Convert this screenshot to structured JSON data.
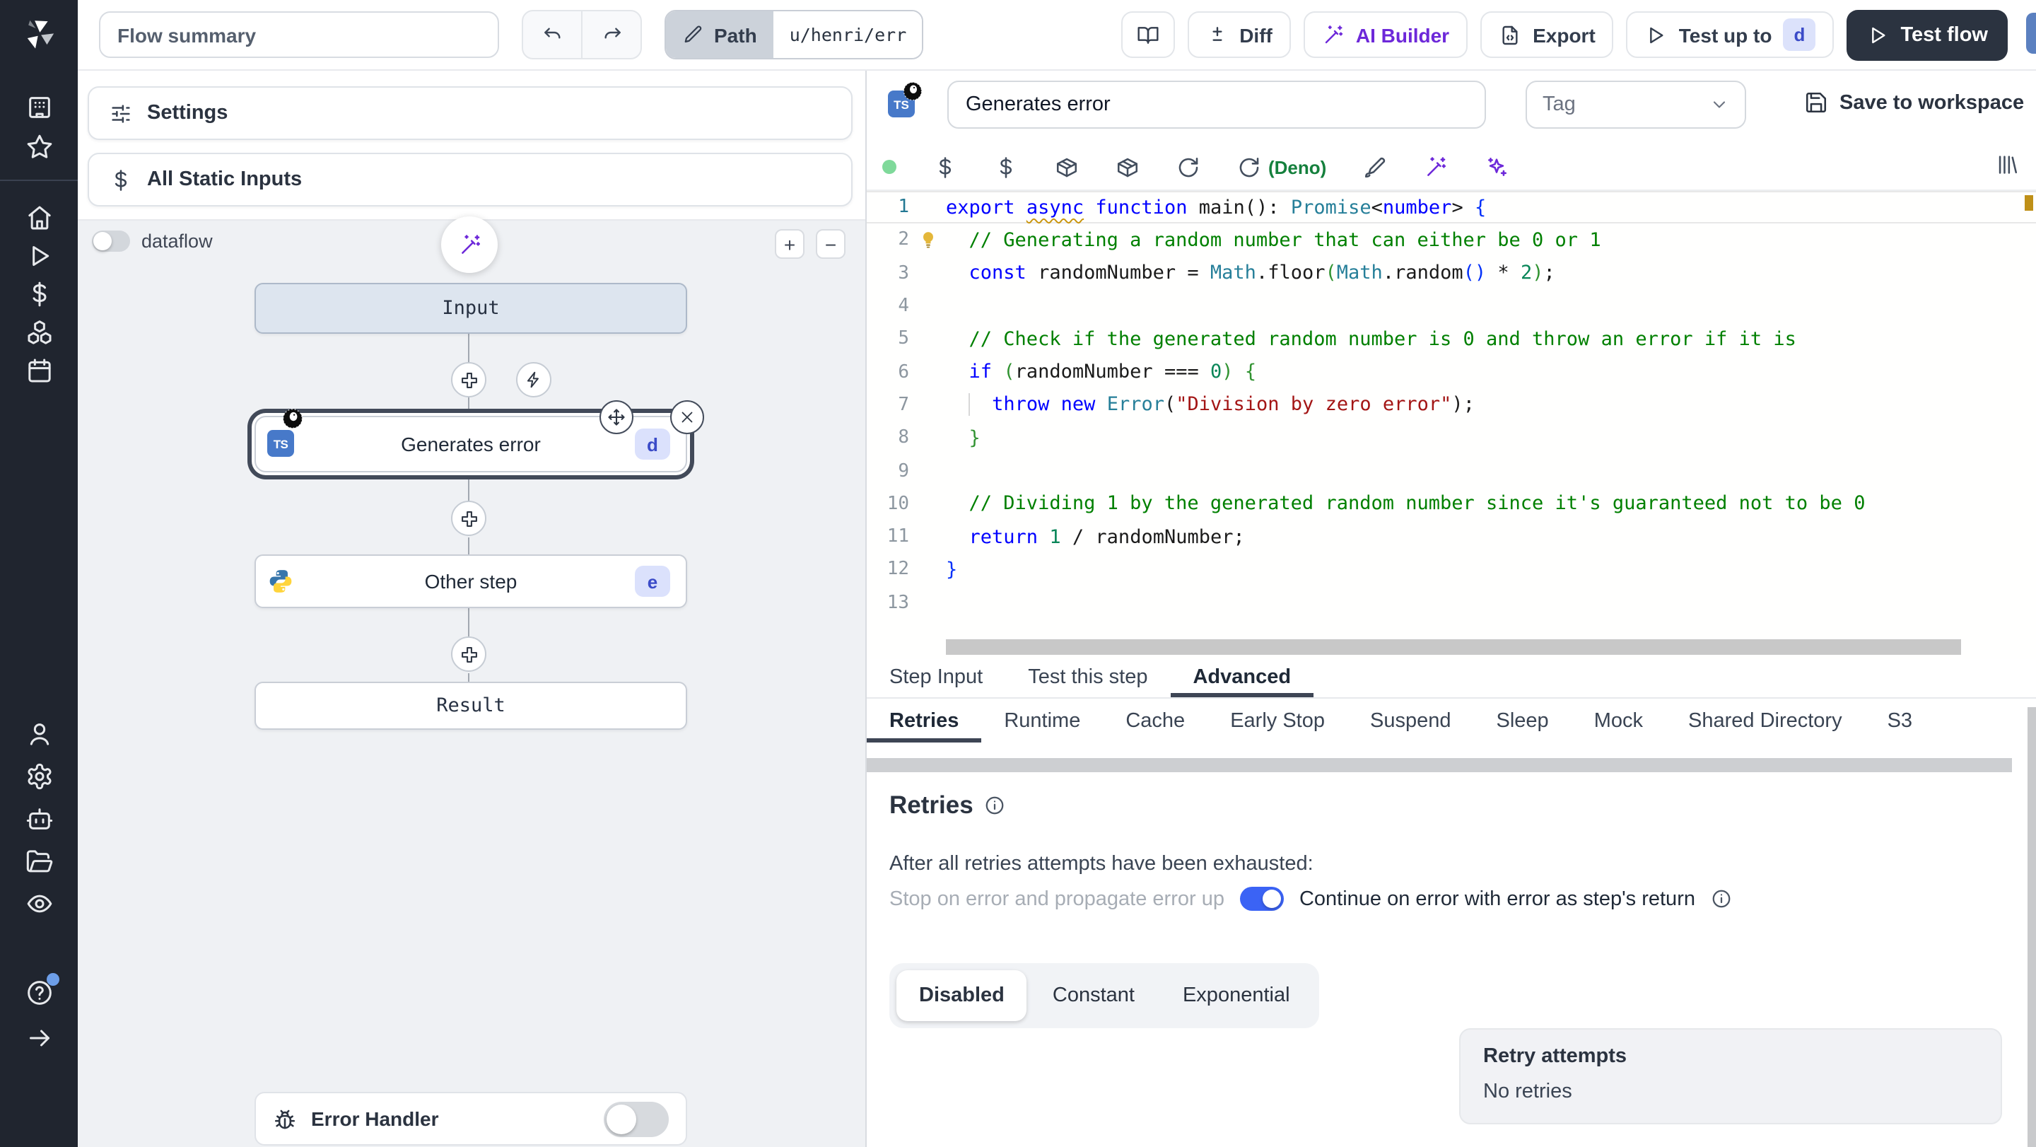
{
  "topbar": {
    "flow_summary": "Flow summary",
    "path_label": "Path",
    "path_value": "u/henri/err",
    "diff_label": "Diff",
    "ai_builder_label": "AI Builder",
    "export_label": "Export",
    "test_up_to_label": "Test up to",
    "test_up_to_badge": "d",
    "test_flow_label": "Test flow"
  },
  "sidebar": {
    "groups": [
      {
        "id": "side-top",
        "items": [
          {
            "name": "sidebar-item-workspace",
            "icon": "building-icon"
          },
          {
            "name": "sidebar-item-favorites",
            "icon": "star-icon"
          }
        ]
      },
      {
        "id": "side-mid",
        "items": [
          {
            "name": "sidebar-item-home",
            "icon": "home-icon"
          },
          {
            "name": "sidebar-item-runs",
            "icon": "runs-icon"
          },
          {
            "name": "sidebar-item-variables",
            "icon": "dollar-icon"
          },
          {
            "name": "sidebar-item-resources",
            "icon": "resources-icon"
          },
          {
            "name": "sidebar-item-schedules",
            "icon": "calendar-icon"
          }
        ]
      },
      {
        "id": "side-bot",
        "items": [
          {
            "name": "sidebar-item-users",
            "icon": "user-icon"
          },
          {
            "name": "sidebar-item-settings",
            "icon": "gear-icon"
          },
          {
            "name": "sidebar-item-ai",
            "icon": "bot-icon"
          },
          {
            "name": "sidebar-item-folders",
            "icon": "folder-icon"
          },
          {
            "name": "sidebar-item-audit",
            "icon": "eye-icon"
          }
        ]
      },
      {
        "id": "side-help",
        "items": [
          {
            "name": "sidebar-item-help",
            "icon": "help-icon",
            "badge": true
          }
        ]
      },
      {
        "id": "side-expand",
        "items": [
          {
            "name": "sidebar-expand",
            "icon": "expand-icon"
          }
        ]
      }
    ]
  },
  "flow_panel": {
    "settings_label": "Settings",
    "static_inputs_label": "All Static Inputs",
    "dataflow_label": "dataflow",
    "zoom_in": "+",
    "zoom_out": "−",
    "nodes": {
      "input_label": "Input",
      "step1_label": "Generates error",
      "step1_badge": "d",
      "step2_label": "Other step",
      "step2_badge": "e",
      "result_label": "Result"
    },
    "error_handler_label": "Error Handler"
  },
  "step_panel": {
    "name_value": "Generates error",
    "tag_placeholder": "Tag",
    "save_label": "Save to workspace",
    "deno_label": "(Deno)",
    "ts_label": "TS",
    "toolbar_items": [
      {
        "icon": "status-dot-icon"
      },
      {
        "icon": "dollar-icon"
      },
      {
        "icon": "dollar-icon"
      },
      {
        "icon": "package-icon"
      },
      {
        "icon": "package-icon"
      },
      {
        "icon": "reload-icon"
      },
      {
        "icon": "reload-icon",
        "label": "(Deno)"
      },
      {
        "icon": "brush-icon"
      },
      {
        "icon": "wand-icon",
        "purple": true
      },
      {
        "icon": "sparkles-icon",
        "purple": true
      }
    ]
  },
  "editor": {
    "lines": [
      {
        "n": 1,
        "active": true,
        "tokens": [
          [
            "k",
            "export"
          ],
          [
            "p",
            " "
          ],
          [
            "ks",
            "async"
          ],
          [
            "p",
            " "
          ],
          [
            "k",
            "function"
          ],
          [
            "p",
            " "
          ],
          [
            "p",
            "main"
          ],
          [
            "p",
            "(): "
          ],
          [
            "t",
            "Promise"
          ],
          [
            "p",
            "<"
          ],
          [
            "k",
            "number"
          ],
          [
            "p",
            "> "
          ],
          [
            "b1",
            "{"
          ]
        ]
      },
      {
        "n": 2,
        "bulb": true,
        "tokens": [
          [
            "p",
            "  "
          ],
          [
            "c",
            "// Generating a random number that can either be 0 or 1"
          ]
        ]
      },
      {
        "n": 3,
        "tokens": [
          [
            "p",
            "  "
          ],
          [
            "k",
            "const"
          ],
          [
            "p",
            " randomNumber = "
          ],
          [
            "t",
            "Math"
          ],
          [
            "p",
            ".floor"
          ],
          [
            "b2",
            "("
          ],
          [
            "t",
            "Math"
          ],
          [
            "p",
            ".random"
          ],
          [
            "b1",
            "()"
          ],
          [
            "p",
            " * "
          ],
          [
            "n",
            "2"
          ],
          [
            "b2",
            ")"
          ],
          [
            "p",
            ";"
          ]
        ]
      },
      {
        "n": 4,
        "tokens": []
      },
      {
        "n": 5,
        "tokens": [
          [
            "p",
            "  "
          ],
          [
            "c",
            "// Check if the generated random number is 0 and throw an error if it is"
          ]
        ]
      },
      {
        "n": 6,
        "tokens": [
          [
            "p",
            "  "
          ],
          [
            "k",
            "if"
          ],
          [
            "p",
            " "
          ],
          [
            "b2",
            "("
          ],
          [
            "p",
            "randomNumber === "
          ],
          [
            "n",
            "0"
          ],
          [
            "b2",
            ")"
          ],
          [
            "p",
            " "
          ],
          [
            "b2",
            "{"
          ]
        ]
      },
      {
        "n": 7,
        "tokens": [
          [
            "p",
            "  "
          ],
          [
            "g",
            "  "
          ],
          [
            "k",
            "throw"
          ],
          [
            "p",
            " "
          ],
          [
            "k",
            "new"
          ],
          [
            "p",
            " "
          ],
          [
            "t",
            "Error"
          ],
          [
            "p",
            "("
          ],
          [
            "s",
            "\"Division by zero error\""
          ],
          [
            "p",
            ")"
          ],
          [
            "p",
            ";"
          ]
        ]
      },
      {
        "n": 8,
        "tokens": [
          [
            "p",
            "  "
          ],
          [
            "b2",
            "}"
          ]
        ]
      },
      {
        "n": 9,
        "tokens": []
      },
      {
        "n": 10,
        "tokens": [
          [
            "p",
            "  "
          ],
          [
            "c",
            "// Dividing 1 by the generated random number since it's guaranteed not to be 0"
          ]
        ]
      },
      {
        "n": 11,
        "tokens": [
          [
            "p",
            "  "
          ],
          [
            "k",
            "return"
          ],
          [
            "p",
            " "
          ],
          [
            "n",
            "1"
          ],
          [
            "p",
            " / randomNumber;"
          ]
        ]
      },
      {
        "n": 12,
        "tokens": [
          [
            "b1",
            "}"
          ]
        ]
      },
      {
        "n": 13,
        "tokens": []
      }
    ]
  },
  "tabs": {
    "items": [
      "Step Input",
      "Test this step",
      "Advanced"
    ],
    "active": 2
  },
  "subtabs": {
    "items": [
      "Retries",
      "Runtime",
      "Cache",
      "Early Stop",
      "Suspend",
      "Sleep",
      "Mock",
      "Shared Directory",
      "S3"
    ],
    "active": 0
  },
  "retries": {
    "title": "Retries",
    "exhausted_label": "After all retries attempts have been exhausted:",
    "toggle_off_label": "Stop on error and propagate error up",
    "toggle_on_label": "Continue on error with error as step's return",
    "modes": [
      "Disabled",
      "Constant",
      "Exponential"
    ],
    "active_mode": 0,
    "card_title": "Retry attempts",
    "card_value": "No retries"
  },
  "colors": {
    "accent_purple": "#6d28d9",
    "deno_green": "#15803d",
    "badge_bg": "#dbe1fc",
    "badge_text": "#3b4bc8",
    "toggle_on_blue": "#3b63f5",
    "test_flow_dark": "#2b3340"
  }
}
